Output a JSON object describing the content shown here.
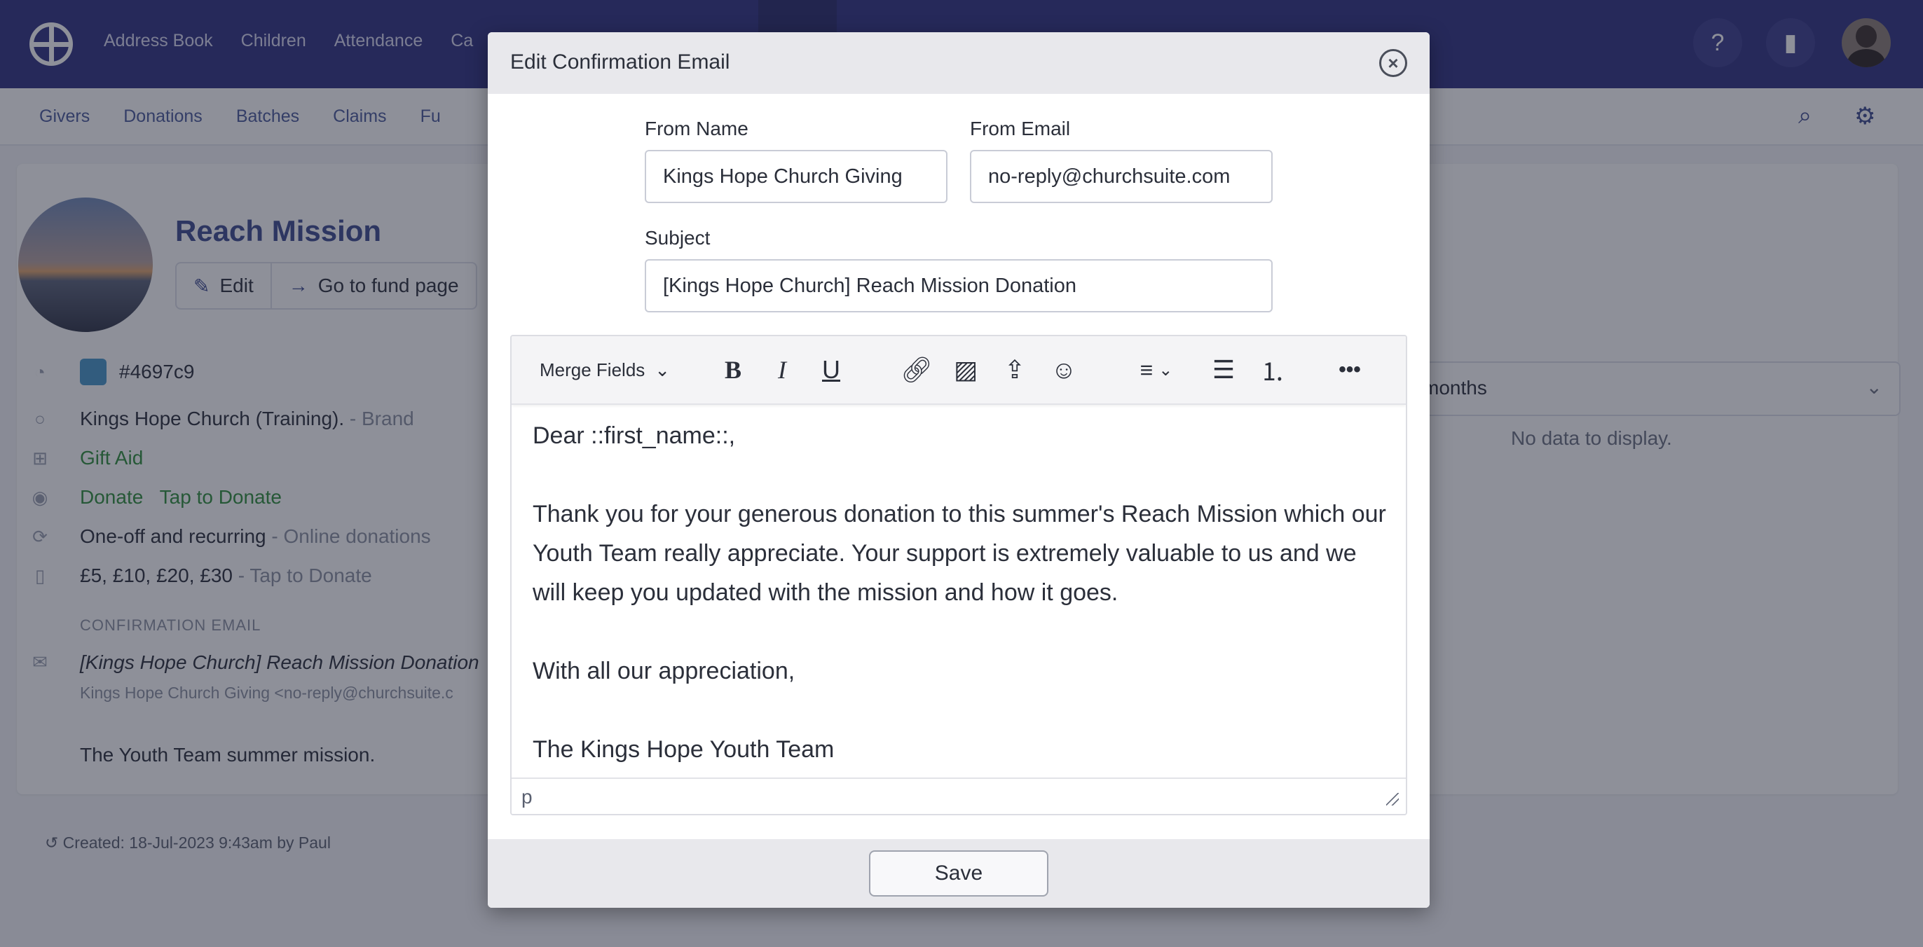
{
  "topnav": [
    "Address Book",
    "Children",
    "Attendance",
    "Ca"
  ],
  "subnav": [
    "Givers",
    "Donations",
    "Batches",
    "Claims",
    "Fu"
  ],
  "fund": {
    "title": "Reach Mission",
    "edit_label": "Edit",
    "goto_label": "Go to fund page",
    "color_hex": "#4697c9",
    "brand_name": "Kings Hope Church (Training).",
    "brand_suffix": "- Brand",
    "gift_aid": "Gift Aid",
    "donate": "Donate",
    "tap_to_donate": "Tap to Donate",
    "frequency": "One-off and recurring",
    "frequency_suffix": "- Online donations",
    "amounts": "£5, £10, £20, £30",
    "amounts_suffix": "- Tap to Donate",
    "confirmation_label": "CONFIRMATION EMAIL",
    "confirmation_subject": "[Kings Hope Church] Reach Mission Donation",
    "confirmation_from": "Kings Hope Church Giving  <no-reply@churchsuite.c",
    "description": "The Youth Team summer mission.",
    "created": "Created: 18-Jul-2023 9:43am by Paul"
  },
  "right_panel": {
    "select_text": "months",
    "no_data": "No data to display."
  },
  "modal": {
    "title": "Edit Confirmation Email",
    "from_name_label": "From Name",
    "from_name_value": "Kings Hope Church Giving",
    "from_email_label": "From Email",
    "from_email_value": "no-reply@churchsuite.com",
    "subject_label": "Subject",
    "subject_value": "[Kings Hope Church] Reach Mission Donation",
    "merge_fields_label": "Merge Fields",
    "body": {
      "greeting": "Dear ::first_name::,",
      "paragraph": "Thank you for your generous donation to this summer's Reach Mission which our Youth Team really appreciate. Your support is extremely valuable to us and we will keep you updated with the mission and how it goes.",
      "closing": "With all our appreciation,",
      "signature": "The Kings Hope Youth Team"
    },
    "status_path": "p",
    "save_label": "Save"
  },
  "colors": {
    "topbar": "#2f3180",
    "fund_swatch": "#4697c9",
    "link": "#3d4a8f"
  }
}
